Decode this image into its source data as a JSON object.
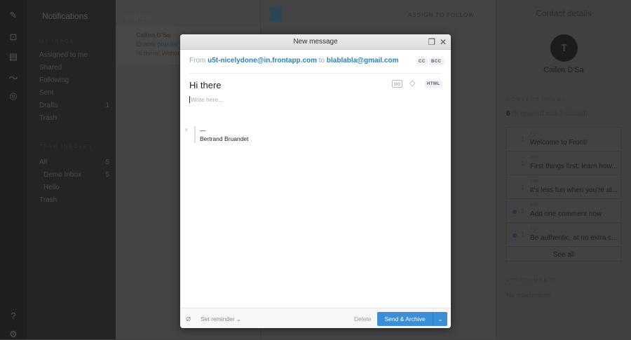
{
  "sidebar": {
    "title": "Notifications",
    "section_mine": "MY INBOX",
    "items": [
      {
        "label": "Assigned to me"
      },
      {
        "label": "Shared"
      },
      {
        "label": "Following"
      },
      {
        "label": "Sent"
      },
      {
        "label": "Drafts",
        "count": "1"
      },
      {
        "label": "Trash"
      }
    ],
    "section_team": "TEAM INBOXES",
    "team_items": [
      {
        "label": "All",
        "count": "5"
      },
      {
        "label": "Demo Inbox",
        "count": "5"
      },
      {
        "label": "Hello"
      },
      {
        "label": "Trash"
      }
    ]
  },
  "list": {
    "search": "popular",
    "item": {
      "sender": "Cailen D'Sa",
      "subject_prefix": "Enable ",
      "subject_highlight": "popular",
      "preview": "Hi there! Without"
    }
  },
  "conversation": {
    "assign": "ASSIGN TO",
    "follow": "FOLLOW"
  },
  "contact": {
    "header": "Contact details",
    "initial": "T",
    "name": "Cailen D'Sa",
    "conversations_label": "CONVERSATIONS",
    "count": "6",
    "count_detail": "(5 opened and 1 closed)",
    "items": [
      {
        "time": "15M",
        "count": "1",
        "subject": "Welcome to Front!"
      },
      {
        "time": "20M",
        "count": "1",
        "subject": "First things first: learn how..."
      },
      {
        "time": "25M",
        "count": "1",
        "subject": "It's less fun when you're al..."
      },
      {
        "time": "30M",
        "count": "1",
        "subject": "Add one comment now"
      },
      {
        "time": "35M",
        "count": "1",
        "subject": "Be authentic, at no extra c..."
      }
    ],
    "see_all": "See all",
    "attachments_label": "ATTACHMENTS",
    "no_attachments": "No attachments"
  },
  "composer": {
    "title": "New message",
    "from_label": "From",
    "from": "u5t-nicelydone@in.frontapp.com",
    "to_label": "to",
    "to": "blablabla@gmail.com",
    "cc": "CC",
    "bcc": "BCC",
    "html": "HTML",
    "subject": "Hi there",
    "placeholder": "Write here...",
    "sig_dash": "—",
    "signature": "Bertrand Bruandet",
    "reminder": "Set reminder",
    "delete": "Delete",
    "send": "Send & Archive"
  }
}
